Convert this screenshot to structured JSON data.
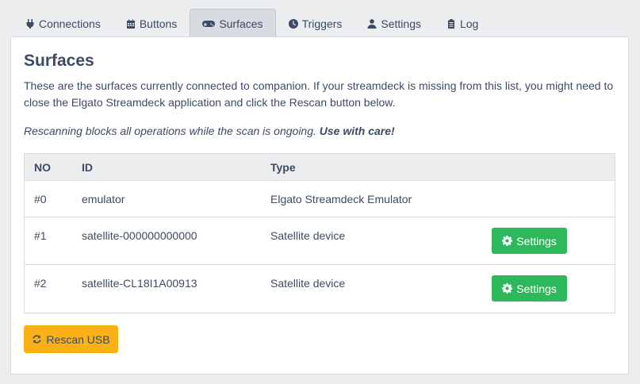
{
  "tabs": [
    {
      "label": "Connections",
      "icon": "plug-icon",
      "active": false
    },
    {
      "label": "Buttons",
      "icon": "calendar-grid-icon",
      "active": false
    },
    {
      "label": "Surfaces",
      "icon": "gamepad-icon",
      "active": true
    },
    {
      "label": "Triggers",
      "icon": "clock-icon",
      "active": false
    },
    {
      "label": "Settings",
      "icon": "user-cog-icon",
      "active": false
    },
    {
      "label": "Log",
      "icon": "clipboard-icon",
      "active": false
    }
  ],
  "page": {
    "title": "Surfaces",
    "description": "These are the surfaces currently connected to companion. If your streamdeck is missing from this list, you might need to close the Elgato Streamdeck application and click the Rescan button below.",
    "warning_text": "Rescanning blocks all operations while the scan is ongoing.",
    "warning_emphasis": "Use with care!"
  },
  "table": {
    "headers": {
      "no": "NO",
      "id": "ID",
      "type": "Type"
    },
    "rows": [
      {
        "no": "#0",
        "id": "emulator",
        "type": "Elgato Streamdeck Emulator",
        "has_settings": false
      },
      {
        "no": "#1",
        "id": "satellite-000000000000",
        "type": "Satellite device",
        "has_settings": true
      },
      {
        "no": "#2",
        "id": "satellite-CL18I1A00913",
        "type": "Satellite device",
        "has_settings": true
      }
    ],
    "settings_label": "Settings"
  },
  "rescan_label": "Rescan USB",
  "colors": {
    "accent_red": "#e55353",
    "success_green": "#2eb85c",
    "warning_yellow": "#f9b115",
    "text": "#3c4b64"
  }
}
